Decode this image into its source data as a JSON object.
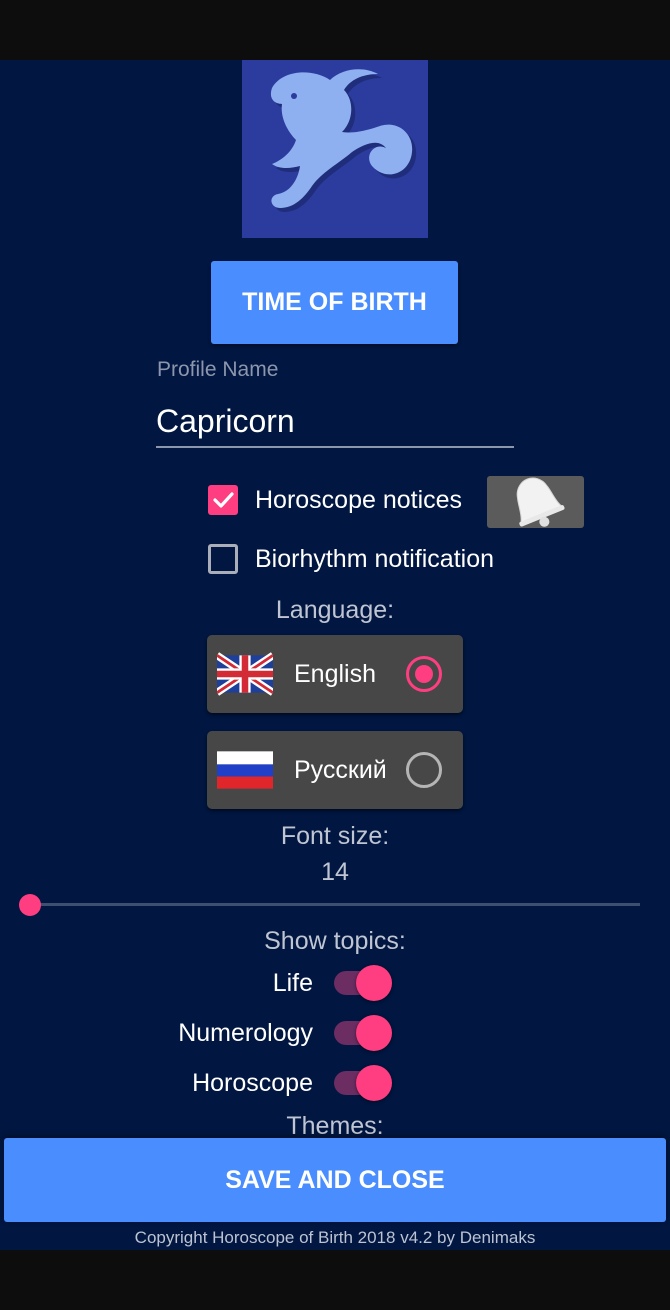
{
  "header": {
    "zodiac_icon": "capricorn-icon",
    "time_of_birth_label": "TIME OF BIRTH"
  },
  "profile": {
    "label": "Profile Name",
    "value": "Capricorn"
  },
  "notifications": {
    "horoscope_label": "Horoscope notices",
    "horoscope_checked": true,
    "bell_icon": "bell-icon",
    "biorhythm_label": "Biorhythm notification",
    "biorhythm_checked": false
  },
  "language": {
    "title": "Language:",
    "options": [
      {
        "label": "English",
        "flag": "uk-flag-icon",
        "selected": true
      },
      {
        "label": "Русский",
        "flag": "russia-flag-icon",
        "selected": false
      }
    ]
  },
  "font_size": {
    "title": "Font size:",
    "value": "14",
    "slider_fraction": 0.0
  },
  "topics": {
    "title": "Show topics:",
    "items": [
      {
        "label": "Life",
        "enabled": true
      },
      {
        "label": "Numerology",
        "enabled": true
      },
      {
        "label": "Horoscope",
        "enabled": true
      }
    ]
  },
  "themes": {
    "title": "Themes:"
  },
  "footer": {
    "save_label": "SAVE AND CLOSE",
    "copyright": "Copyright Horoscope of Birth 2018 v4.2 by Denimaks"
  },
  "colors": {
    "background": "#011640",
    "accent": "#ff3d81",
    "button": "#4a8dff"
  }
}
